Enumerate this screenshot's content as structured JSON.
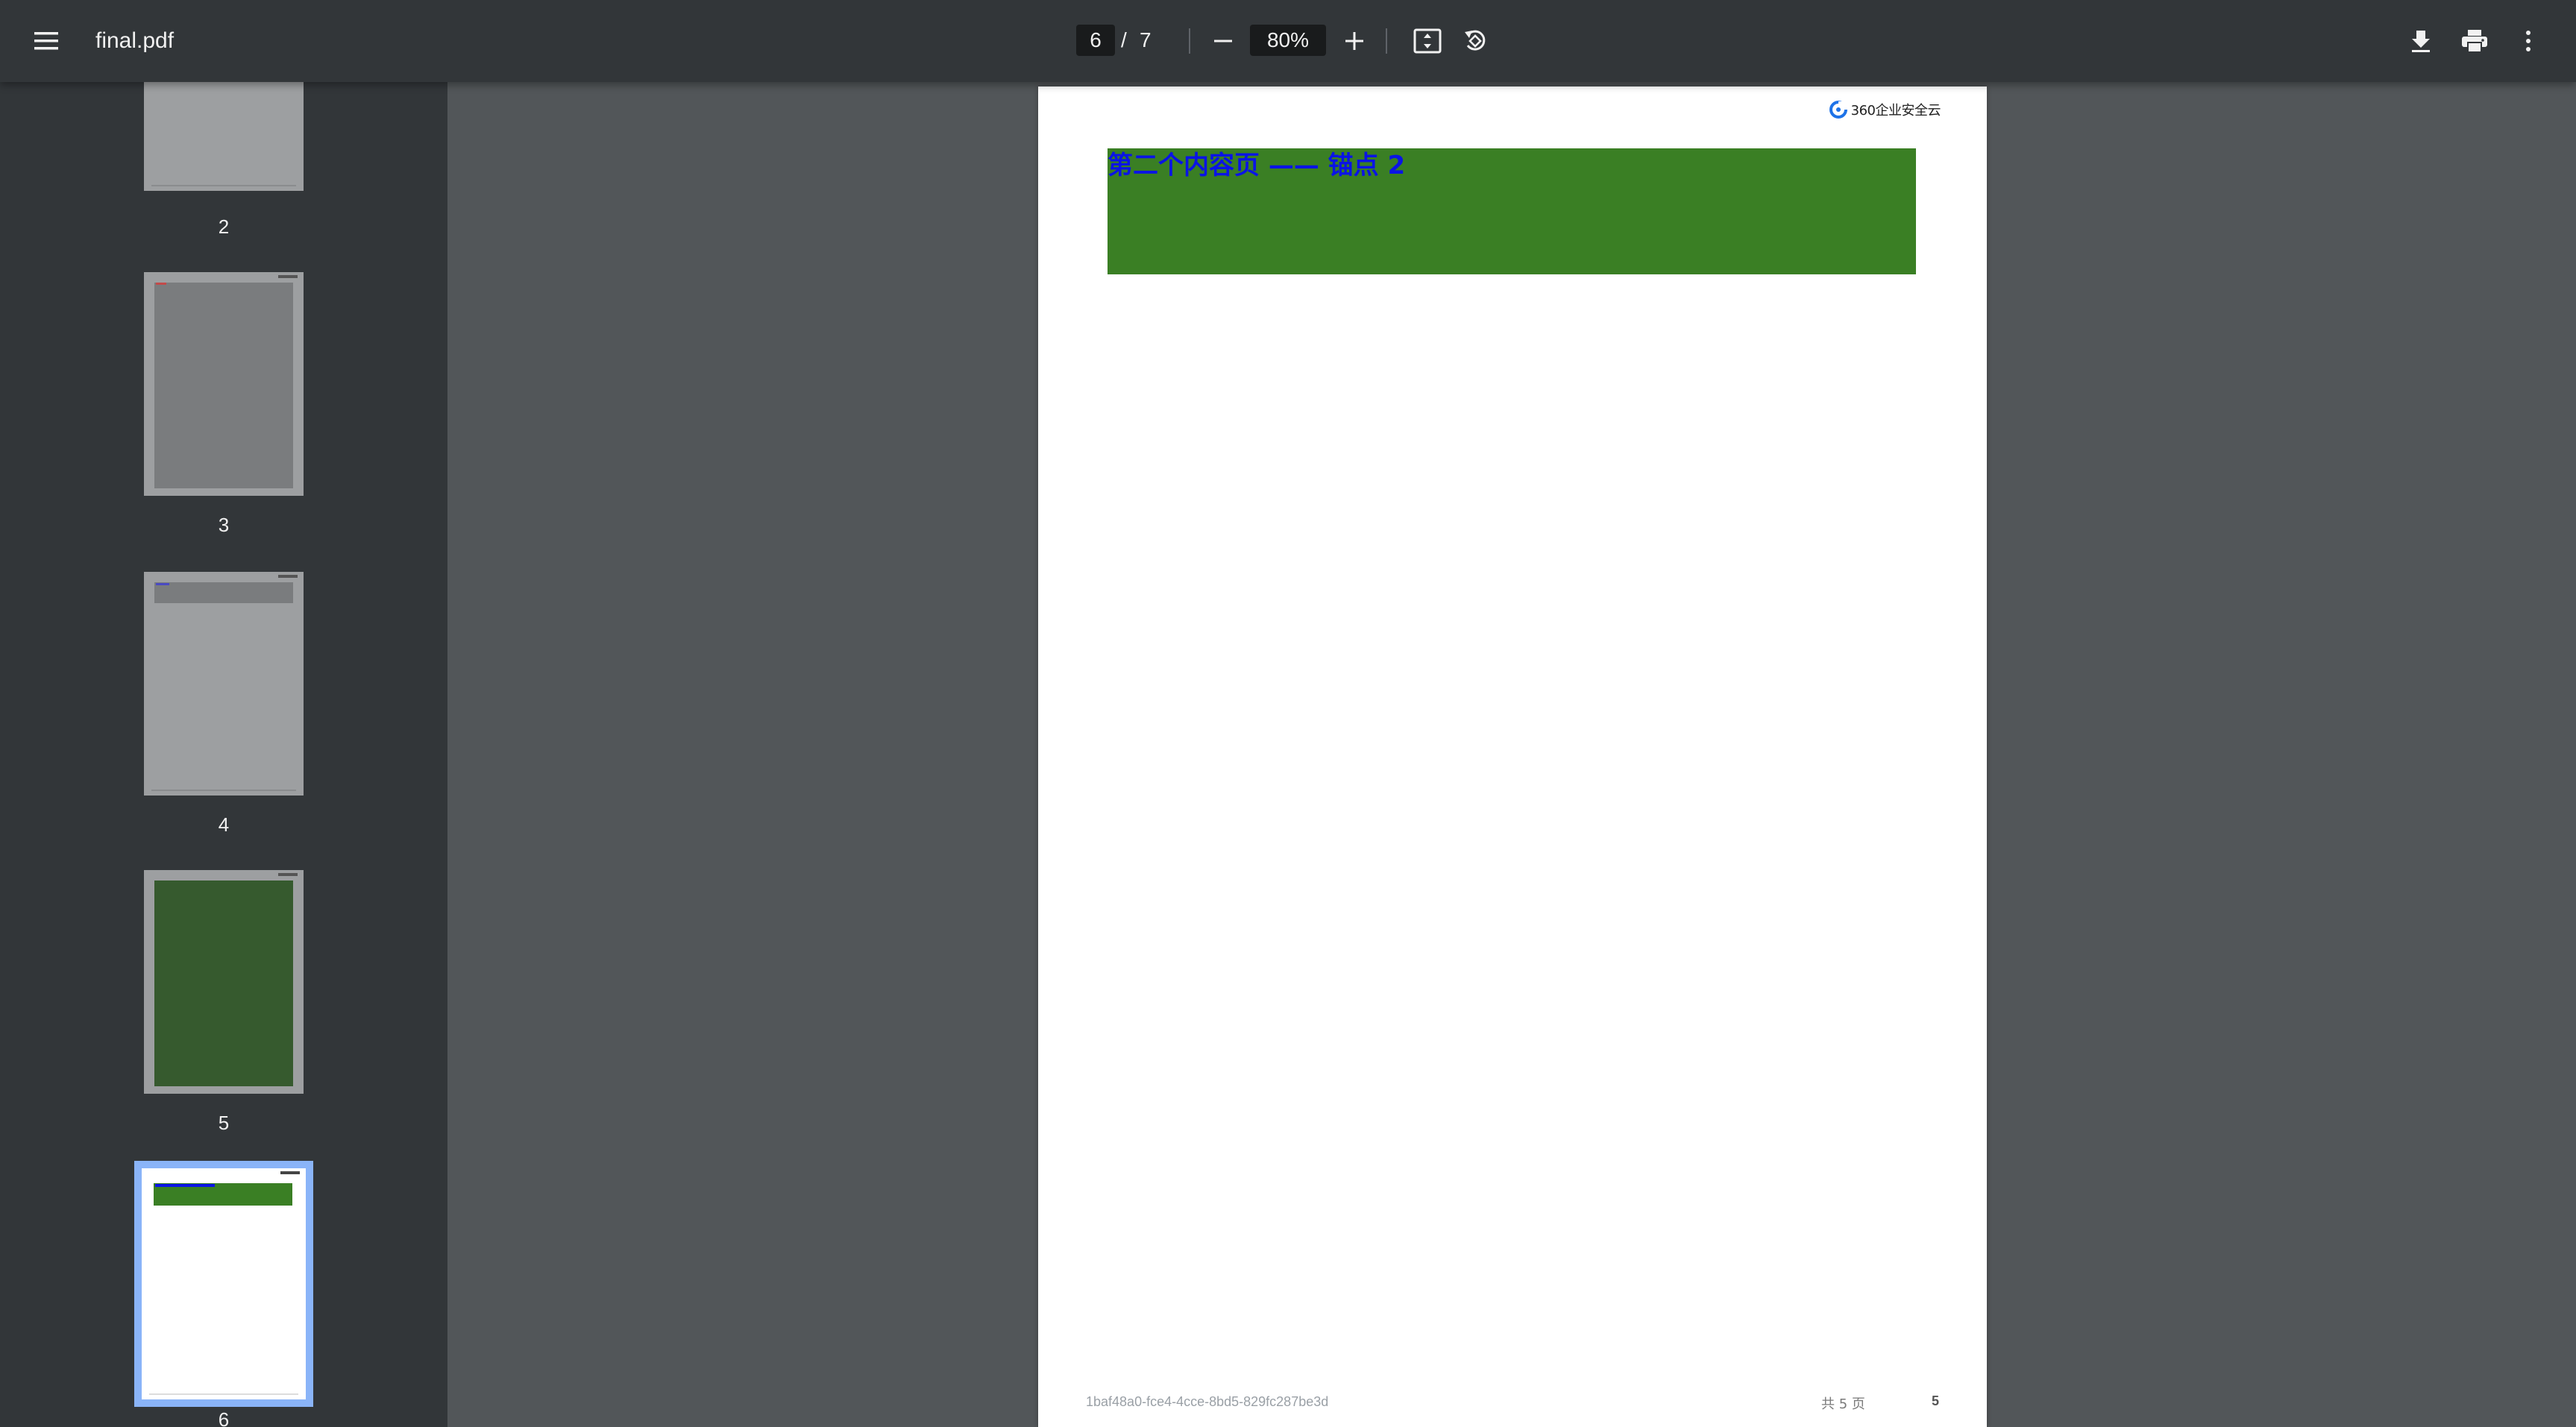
{
  "toolbar": {
    "file_name": "final.pdf",
    "current_page": "6",
    "page_separator": "/",
    "total_pages": "7",
    "zoom": "80%"
  },
  "sidebar": {
    "thumbnails": [
      {
        "label": "2"
      },
      {
        "label": "3"
      },
      {
        "label": "4"
      },
      {
        "label": "5"
      },
      {
        "label": "6"
      }
    ],
    "selected": "6"
  },
  "page": {
    "brand_text": "360企业安全云",
    "heading": "第二个内容页 —— 锚点 2",
    "footer_id": "1baf48a0-fce4-4cce-8bd5-829fc287be3d",
    "footer_total": "共 5 页",
    "footer_page_number": "5"
  },
  "colors": {
    "toolbar_bg": "#323639",
    "viewer_bg": "#525659",
    "green_block": "#3a7f24",
    "heading_text": "#0a14e6",
    "selection_outline": "#8ab4f8"
  },
  "icons": [
    "menu-icon",
    "minus-icon",
    "plus-icon",
    "fit-page-icon",
    "rotate-icon",
    "download-icon",
    "print-icon",
    "more-vert-icon",
    "brand-logo-icon"
  ]
}
